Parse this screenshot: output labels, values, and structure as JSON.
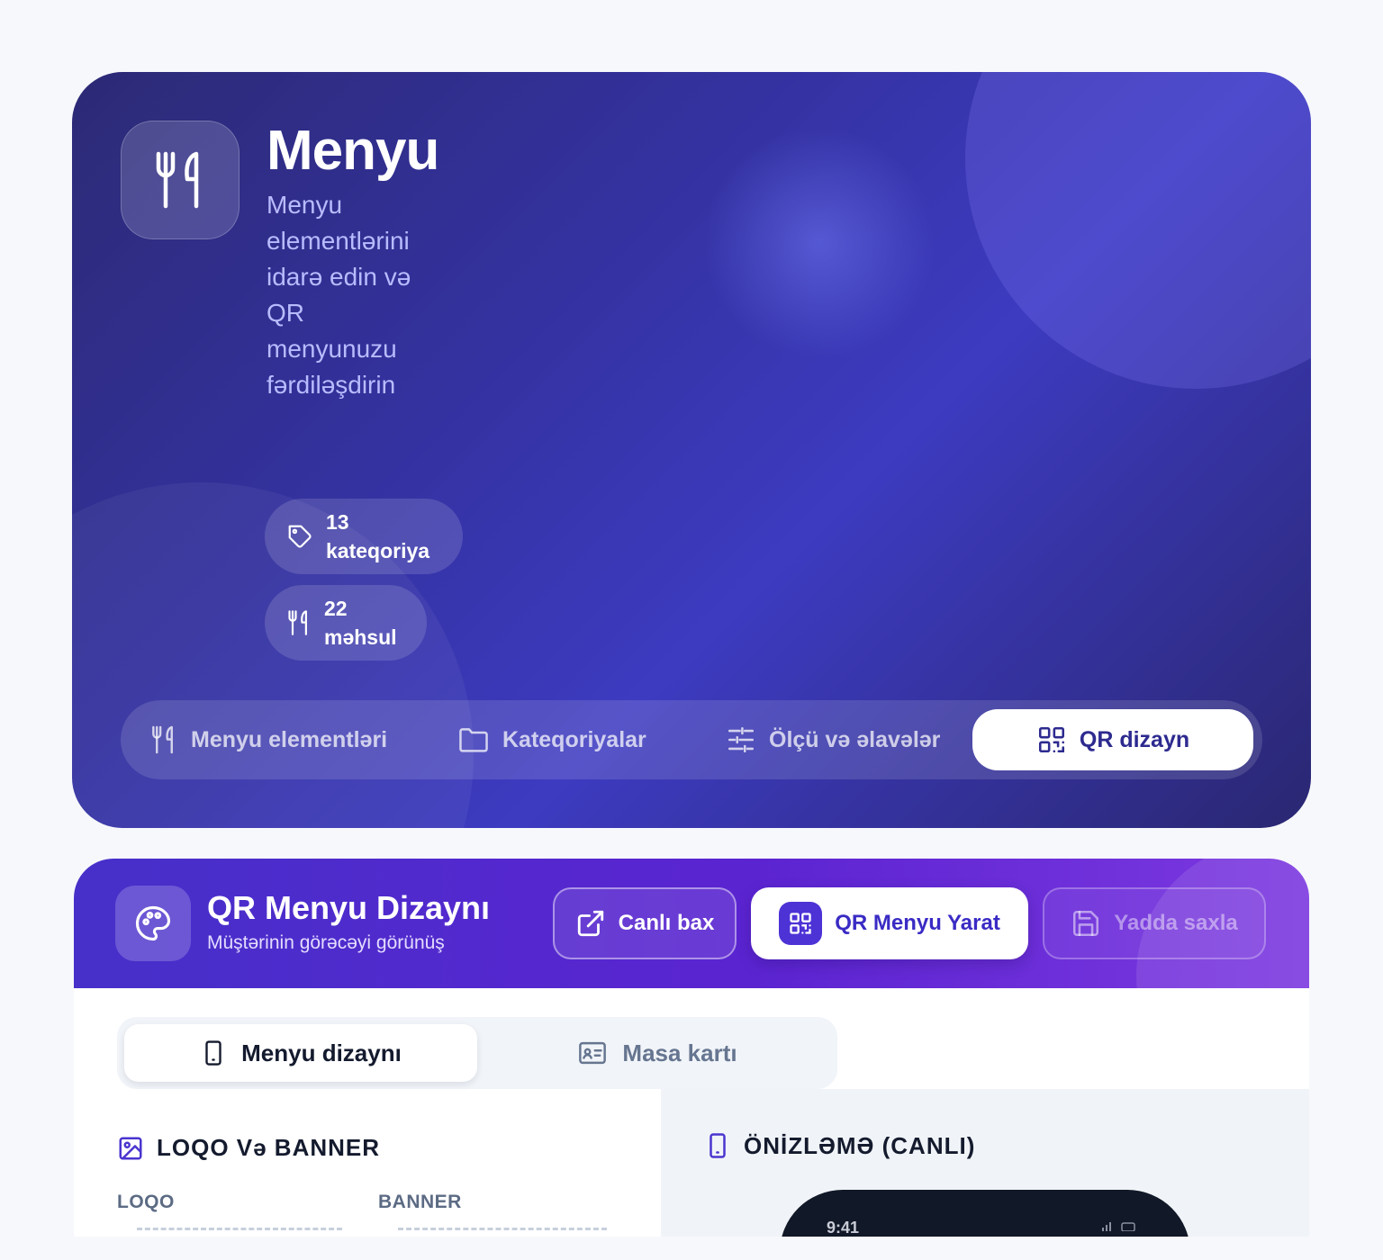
{
  "hero": {
    "title": "Menyu",
    "subtitle": "Menyu elementlərini idarə edin və QR menyunuzu fərdiləşdirin",
    "icon": "fork-knife-icon",
    "stats": [
      {
        "number": "13",
        "label": "kateqoriya",
        "icon": "tag-icon"
      },
      {
        "number": "22",
        "label": "məhsul",
        "icon": "fork-knife-icon"
      }
    ],
    "tabs": [
      {
        "label": "Menyu elementləri",
        "icon": "fork-knife-icon",
        "active": false
      },
      {
        "label": "Kateqoriyalar",
        "icon": "folder-icon",
        "active": false
      },
      {
        "label": "Ölçü və əlavələr",
        "icon": "sliders-icon",
        "active": false
      },
      {
        "label": "QR dizayn",
        "icon": "qr-code-icon",
        "active": true
      }
    ]
  },
  "design": {
    "title": "QR Menyu Dizaynı",
    "subtitle": "Müştərinin görəcəyi görünüş",
    "header_icon": "palette-icon",
    "buttons": {
      "live": "Canlı bax",
      "create_qr": "QR Menyu Yarat",
      "save": "Yadda saxla"
    },
    "segments": [
      {
        "label": "Menyu dizaynı",
        "icon": "phone-icon",
        "active": true
      },
      {
        "label": "Masa kartı",
        "icon": "id-card-icon",
        "active": false
      }
    ],
    "logo_section": {
      "title": "LOQO Və BANNER",
      "logo_label": "LOQO",
      "banner_label": "BANNER"
    },
    "preview_section": {
      "title": "ÖNİZLƏMƏ (CANLI)",
      "phone_time": "9:41"
    }
  },
  "colors": {
    "hero_bg": "#3432a0",
    "accent": "#4d33d6",
    "header_gradient_end": "#7c38e0"
  }
}
